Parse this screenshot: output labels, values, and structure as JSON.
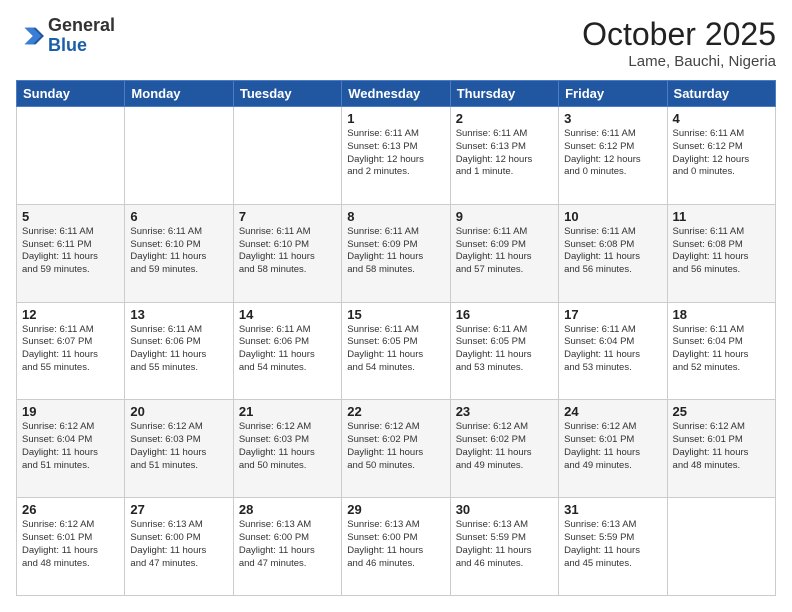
{
  "header": {
    "logo": {
      "general": "General",
      "blue": "Blue"
    },
    "title": "October 2025",
    "location": "Lame, Bauchi, Nigeria"
  },
  "days_of_week": [
    "Sunday",
    "Monday",
    "Tuesday",
    "Wednesday",
    "Thursday",
    "Friday",
    "Saturday"
  ],
  "weeks": [
    [
      {
        "day": "",
        "lines": []
      },
      {
        "day": "",
        "lines": []
      },
      {
        "day": "",
        "lines": []
      },
      {
        "day": "1",
        "lines": [
          "Sunrise: 6:11 AM",
          "Sunset: 6:13 PM",
          "Daylight: 12 hours",
          "and 2 minutes."
        ]
      },
      {
        "day": "2",
        "lines": [
          "Sunrise: 6:11 AM",
          "Sunset: 6:13 PM",
          "Daylight: 12 hours",
          "and 1 minute."
        ]
      },
      {
        "day": "3",
        "lines": [
          "Sunrise: 6:11 AM",
          "Sunset: 6:12 PM",
          "Daylight: 12 hours",
          "and 0 minutes."
        ]
      },
      {
        "day": "4",
        "lines": [
          "Sunrise: 6:11 AM",
          "Sunset: 6:12 PM",
          "Daylight: 12 hours",
          "and 0 minutes."
        ]
      }
    ],
    [
      {
        "day": "5",
        "lines": [
          "Sunrise: 6:11 AM",
          "Sunset: 6:11 PM",
          "Daylight: 11 hours",
          "and 59 minutes."
        ]
      },
      {
        "day": "6",
        "lines": [
          "Sunrise: 6:11 AM",
          "Sunset: 6:10 PM",
          "Daylight: 11 hours",
          "and 59 minutes."
        ]
      },
      {
        "day": "7",
        "lines": [
          "Sunrise: 6:11 AM",
          "Sunset: 6:10 PM",
          "Daylight: 11 hours",
          "and 58 minutes."
        ]
      },
      {
        "day": "8",
        "lines": [
          "Sunrise: 6:11 AM",
          "Sunset: 6:09 PM",
          "Daylight: 11 hours",
          "and 58 minutes."
        ]
      },
      {
        "day": "9",
        "lines": [
          "Sunrise: 6:11 AM",
          "Sunset: 6:09 PM",
          "Daylight: 11 hours",
          "and 57 minutes."
        ]
      },
      {
        "day": "10",
        "lines": [
          "Sunrise: 6:11 AM",
          "Sunset: 6:08 PM",
          "Daylight: 11 hours",
          "and 56 minutes."
        ]
      },
      {
        "day": "11",
        "lines": [
          "Sunrise: 6:11 AM",
          "Sunset: 6:08 PM",
          "Daylight: 11 hours",
          "and 56 minutes."
        ]
      }
    ],
    [
      {
        "day": "12",
        "lines": [
          "Sunrise: 6:11 AM",
          "Sunset: 6:07 PM",
          "Daylight: 11 hours",
          "and 55 minutes."
        ]
      },
      {
        "day": "13",
        "lines": [
          "Sunrise: 6:11 AM",
          "Sunset: 6:06 PM",
          "Daylight: 11 hours",
          "and 55 minutes."
        ]
      },
      {
        "day": "14",
        "lines": [
          "Sunrise: 6:11 AM",
          "Sunset: 6:06 PM",
          "Daylight: 11 hours",
          "and 54 minutes."
        ]
      },
      {
        "day": "15",
        "lines": [
          "Sunrise: 6:11 AM",
          "Sunset: 6:05 PM",
          "Daylight: 11 hours",
          "and 54 minutes."
        ]
      },
      {
        "day": "16",
        "lines": [
          "Sunrise: 6:11 AM",
          "Sunset: 6:05 PM",
          "Daylight: 11 hours",
          "and 53 minutes."
        ]
      },
      {
        "day": "17",
        "lines": [
          "Sunrise: 6:11 AM",
          "Sunset: 6:04 PM",
          "Daylight: 11 hours",
          "and 53 minutes."
        ]
      },
      {
        "day": "18",
        "lines": [
          "Sunrise: 6:11 AM",
          "Sunset: 6:04 PM",
          "Daylight: 11 hours",
          "and 52 minutes."
        ]
      }
    ],
    [
      {
        "day": "19",
        "lines": [
          "Sunrise: 6:12 AM",
          "Sunset: 6:04 PM",
          "Daylight: 11 hours",
          "and 51 minutes."
        ]
      },
      {
        "day": "20",
        "lines": [
          "Sunrise: 6:12 AM",
          "Sunset: 6:03 PM",
          "Daylight: 11 hours",
          "and 51 minutes."
        ]
      },
      {
        "day": "21",
        "lines": [
          "Sunrise: 6:12 AM",
          "Sunset: 6:03 PM",
          "Daylight: 11 hours",
          "and 50 minutes."
        ]
      },
      {
        "day": "22",
        "lines": [
          "Sunrise: 6:12 AM",
          "Sunset: 6:02 PM",
          "Daylight: 11 hours",
          "and 50 minutes."
        ]
      },
      {
        "day": "23",
        "lines": [
          "Sunrise: 6:12 AM",
          "Sunset: 6:02 PM",
          "Daylight: 11 hours",
          "and 49 minutes."
        ]
      },
      {
        "day": "24",
        "lines": [
          "Sunrise: 6:12 AM",
          "Sunset: 6:01 PM",
          "Daylight: 11 hours",
          "and 49 minutes."
        ]
      },
      {
        "day": "25",
        "lines": [
          "Sunrise: 6:12 AM",
          "Sunset: 6:01 PM",
          "Daylight: 11 hours",
          "and 48 minutes."
        ]
      }
    ],
    [
      {
        "day": "26",
        "lines": [
          "Sunrise: 6:12 AM",
          "Sunset: 6:01 PM",
          "Daylight: 11 hours",
          "and 48 minutes."
        ]
      },
      {
        "day": "27",
        "lines": [
          "Sunrise: 6:13 AM",
          "Sunset: 6:00 PM",
          "Daylight: 11 hours",
          "and 47 minutes."
        ]
      },
      {
        "day": "28",
        "lines": [
          "Sunrise: 6:13 AM",
          "Sunset: 6:00 PM",
          "Daylight: 11 hours",
          "and 47 minutes."
        ]
      },
      {
        "day": "29",
        "lines": [
          "Sunrise: 6:13 AM",
          "Sunset: 6:00 PM",
          "Daylight: 11 hours",
          "and 46 minutes."
        ]
      },
      {
        "day": "30",
        "lines": [
          "Sunrise: 6:13 AM",
          "Sunset: 5:59 PM",
          "Daylight: 11 hours",
          "and 46 minutes."
        ]
      },
      {
        "day": "31",
        "lines": [
          "Sunrise: 6:13 AM",
          "Sunset: 5:59 PM",
          "Daylight: 11 hours",
          "and 45 minutes."
        ]
      },
      {
        "day": "",
        "lines": []
      }
    ]
  ]
}
